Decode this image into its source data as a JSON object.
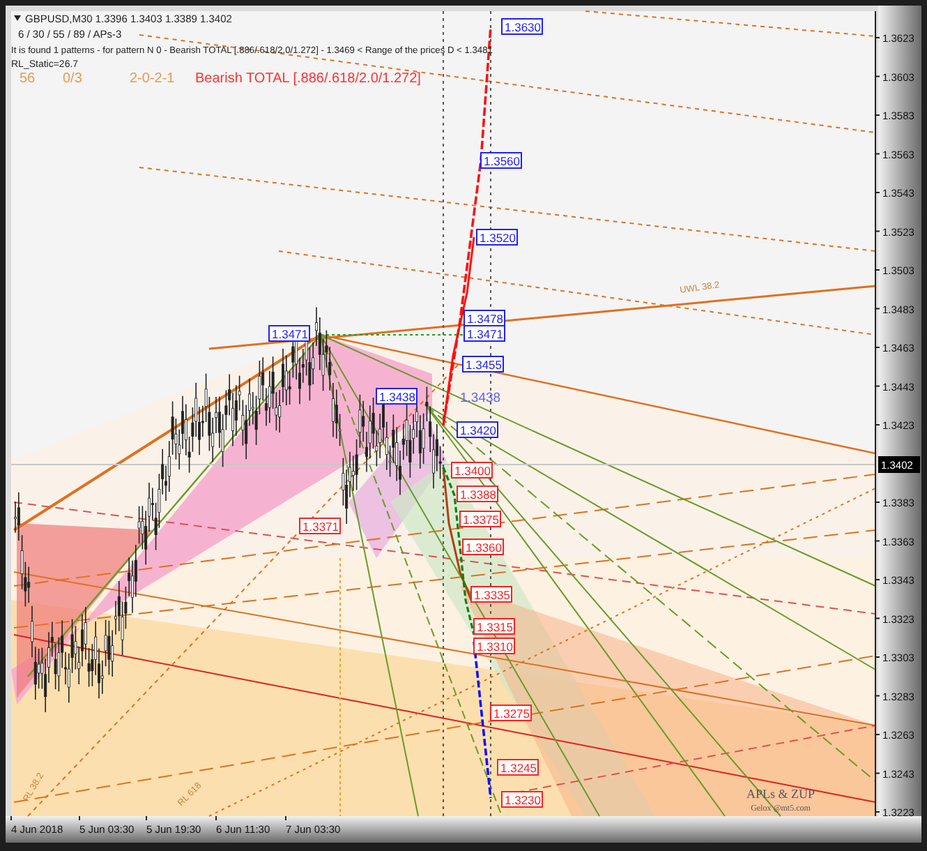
{
  "chart": {
    "symbol_line": "GBPUSD,M30  1.3396 1.3403 1.3389 1.3402",
    "indicator_line": "6 / 30 / 55 / 89 / APs-3",
    "pattern_line": "It is found 1 patterns  -  for pattern N 0 - Bearish TOTAL [.886/.618/2.0/1.272] - 1.3469 < Range of the prices D < 1.3481",
    "rl_static": "RL_Static=26.7",
    "stats": [
      "56",
      "0/3",
      "2-0-2-1"
    ],
    "pattern_name": "Bearish TOTAL [.886/.618/2.0/1.272]",
    "price_axis": [
      "1.3623",
      "1.3603",
      "1.3583",
      "1.3563",
      "1.3543",
      "1.3523",
      "1.3503",
      "1.3483",
      "1.3463",
      "1.3443",
      "1.3423",
      "1.3383",
      "1.3363",
      "1.3343",
      "1.3323",
      "1.3303",
      "1.3283",
      "1.3263",
      "1.3243",
      "1.3223"
    ],
    "current_price": "1.3402",
    "time_axis": [
      "4 Jun 2018",
      "5 Jun 03:30",
      "5 Jun 19:30",
      "6 Jun 11:30",
      "7 Jun 03:30"
    ],
    "level_labels": [
      {
        "text": "1.3630",
        "kind": "box",
        "color": "#2020ff"
      },
      {
        "text": "1.3560",
        "kind": "box",
        "color": "#2020ff"
      },
      {
        "text": "1.3520",
        "kind": "box",
        "color": "#2020ff"
      },
      {
        "text": "1.3478",
        "kind": "box",
        "color": "#2020ff"
      },
      {
        "text": "1.3471",
        "kind": "box",
        "color": "#2020ff"
      },
      {
        "text": "1.3471",
        "kind": "box",
        "color": "#2020ff"
      },
      {
        "text": "1.3455",
        "kind": "box",
        "color": "#2020ff"
      },
      {
        "text": "1.3438",
        "kind": "box",
        "color": "#2020ff"
      },
      {
        "text": "1.3438",
        "kind": "plain",
        "color": "#6060ff"
      },
      {
        "text": "1.3420",
        "kind": "box",
        "color": "#2020ff"
      },
      {
        "text": "1.3400",
        "kind": "box",
        "color": "#ff2020"
      },
      {
        "text": "1.3388",
        "kind": "box",
        "color": "#ff2020"
      },
      {
        "text": "1.3371",
        "kind": "box",
        "color": "#ff2020"
      },
      {
        "text": "1.3375",
        "kind": "box",
        "color": "#ff2020"
      },
      {
        "text": "1.3360",
        "kind": "box",
        "color": "#ff2020"
      },
      {
        "text": "1.3335",
        "kind": "box",
        "color": "#ff2020"
      },
      {
        "text": "1.3315",
        "kind": "box",
        "color": "#ff2020"
      },
      {
        "text": "1.3310",
        "kind": "box",
        "color": "#ff2020"
      },
      {
        "text": "1.3275",
        "kind": "box",
        "color": "#ff2020"
      },
      {
        "text": "1.3245",
        "kind": "box",
        "color": "#ff2020"
      },
      {
        "text": "1.3230",
        "kind": "box",
        "color": "#ff2020"
      }
    ],
    "line_labels": [
      "UWL 38.2",
      "RL 38.2",
      "RL 618"
    ],
    "signature": {
      "title": "APLs & ZUP",
      "subtitle": "Gelox @mt5.com"
    }
  }
}
